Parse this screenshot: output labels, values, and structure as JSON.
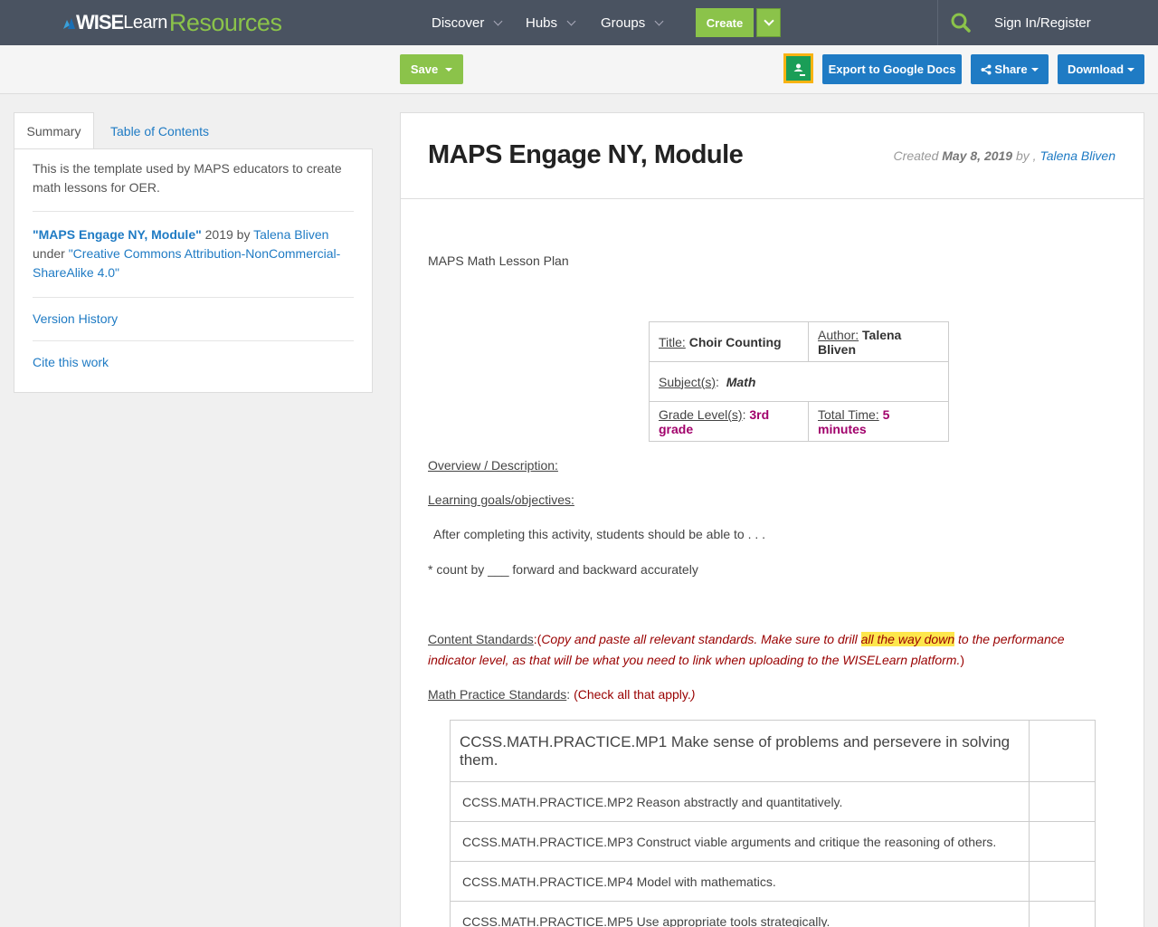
{
  "nav": {
    "logo_wise": "WISE",
    "logo_learn": "Learn",
    "logo_resources": "Resources",
    "items": [
      {
        "label": "Discover"
      },
      {
        "label": "Hubs"
      },
      {
        "label": "Groups"
      }
    ],
    "create_label": "Create",
    "signin_label": "Sign In/Register",
    "colors": {
      "bar": "#4a5361",
      "create": "#8bc34a"
    }
  },
  "toolbar": {
    "save_label": "Save",
    "export_label": "Export to Google Docs",
    "share_label": "Share",
    "download_label": "Download",
    "colors": {
      "primary": "#1f7bc4",
      "save": "#8bc34a",
      "classroom_border": "#f9b312",
      "classroom": "#1a9e57"
    }
  },
  "sidebar": {
    "tabs": [
      {
        "label": "Summary",
        "active": true
      },
      {
        "label": "Table of Contents",
        "active": false
      }
    ],
    "description": "This is the template used by MAPS educators to create math lessons for OER.",
    "license": {
      "title": "\"MAPS Engage NY, Module\"",
      "year_by": " 2019 by ",
      "author": "Talena Bliven",
      "under": "under ",
      "license_name": "\"Creative Commons Attribution-NonCommercial-ShareAlike 4.0\""
    },
    "version_history": "Version History",
    "cite": "Cite this work"
  },
  "main": {
    "title": "MAPS Engage NY, Module",
    "created_prefix": "Created ",
    "created_date": "May 8, 2019",
    "created_by": " by , ",
    "created_author": "Talena Bliven",
    "lesson_heading": "MAPS Math Lesson Plan",
    "lesson_table": {
      "title_label": "Title:",
      "title_value": "Choir Counting",
      "author_label": "Author:",
      "author_value": "Talena Bliven",
      "subject_label": "Subject(s)",
      "subject_sep": ":",
      "subject_value": "Math",
      "grade_label": "Grade Level(s)",
      "grade_sep": ": ",
      "grade_value": "3rd grade",
      "time_label": "Total Time:",
      "time_value": "5 minutes"
    },
    "overview_label": "Overview / Description:",
    "goals_label": "Learning goals/objectives:",
    "goals_intro": "After completing this activity, students should be able to . . .",
    "goal_item": "* count by ___ forward and backward accurately",
    "content_standards_label": "Content Standards",
    "content_standards_sep": ":(",
    "content_standards_note_a": "Copy and paste all relevant standards. Make sure to drill ",
    "content_standards_highlight": "all the way down",
    "content_standards_note_b": " to the performance indicator level, as that will be what you need to link when uploading to the WISELearn platform.",
    "content_standards_close": ")",
    "practice_label": "Math Practice Standards",
    "practice_sep": ": ",
    "practice_note": "(Check all that apply.",
    "practice_note_close": ")",
    "practice_standards": [
      "CCSS.MATH.PRACTICE.MP1 Make sense of problems and persevere in solving them.",
      "CCSS.MATH.PRACTICE.MP2 Reason abstractly and quantitatively.",
      "CCSS.MATH.PRACTICE.MP3 Construct viable arguments and critique the reasoning of others.",
      "CCSS.MATH.PRACTICE.MP4 Model with mathematics.",
      "CCSS.MATH.PRACTICE.MP5 Use appropriate tools strategically."
    ]
  }
}
